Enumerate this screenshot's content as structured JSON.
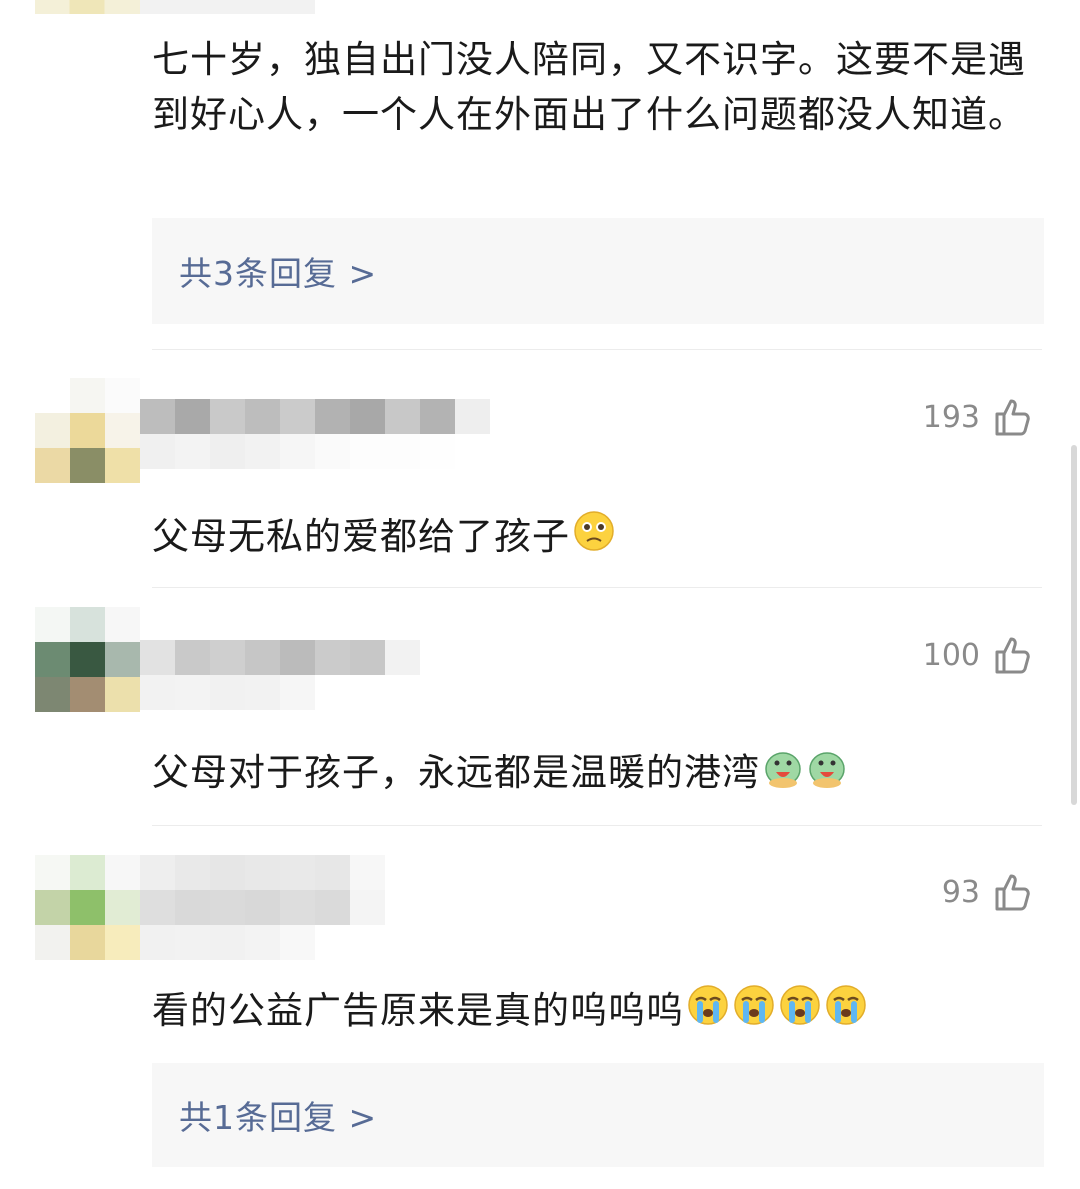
{
  "comments": [
    {
      "text": "七十岁，独自出门没人陪同，又不识字。这要不是遇到好心人，一个人在外面出了什么问题都没人知道。",
      "replies_label": "共3条回复 >"
    },
    {
      "likes": "193",
      "text": "父母无私的爱都给了孩子"
    },
    {
      "likes": "100",
      "text": "父母对于孩子，永远都是温暖的港湾"
    },
    {
      "likes": "93",
      "text": "看的公益广告原来是真的呜呜呜",
      "replies_label": "共1条回复 >"
    }
  ],
  "icons": {
    "like": "thumbs-up-icon",
    "emoji_pleading": "pleading-face-icon",
    "emoji_hug": "dragon-hug-icon",
    "emoji_cry": "crying-face-icon"
  },
  "colors": {
    "link": "#576b95",
    "count": "#8a8a8a",
    "text": "#1a1a1a",
    "reply_bg": "#f7f7f7"
  }
}
